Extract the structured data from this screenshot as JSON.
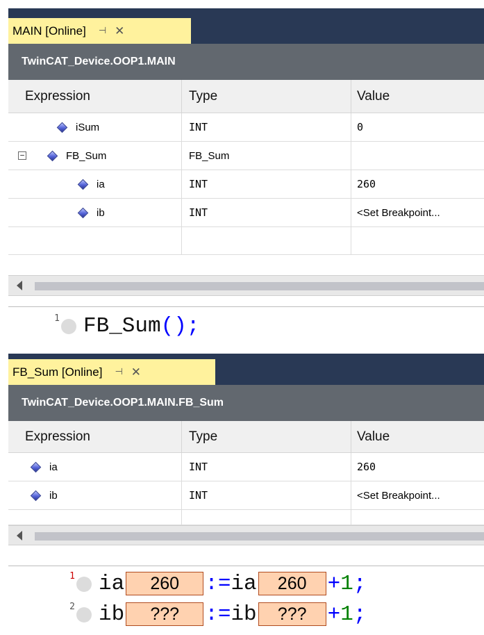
{
  "top_caption": {
    "text": ""
  },
  "panel_main": {
    "tab": {
      "title": "MAIN [Online]",
      "pin": "⊣",
      "close": "✕"
    },
    "path": "TwinCAT_Device.OOP1.MAIN",
    "columns": {
      "expression": "Expression",
      "type": "Type",
      "value": "Value"
    },
    "rows": [
      {
        "expression": "iSum",
        "type": "INT",
        "value": "0",
        "expander": ""
      },
      {
        "expression": "FB_Sum",
        "type": "FB_Sum",
        "value": "",
        "expander": "−"
      },
      {
        "expression": "ia",
        "type": "INT",
        "value": "260",
        "expander": ""
      },
      {
        "expression": "ib",
        "type": "INT",
        "value": "<Set Breakpoint...",
        "expander": ""
      }
    ],
    "code": [
      {
        "line": "1",
        "text": "FB_Sum",
        "suffix": "();"
      }
    ]
  },
  "panel_fb": {
    "tab": {
      "title": "FB_Sum [Online]",
      "pin": "⊣",
      "close": "✕"
    },
    "path": "TwinCAT_Device.OOP1.MAIN.FB_Sum",
    "columns": {
      "expression": "Expression",
      "type": "Type",
      "value": "Value"
    },
    "rows": [
      {
        "expression": "ia",
        "type": "INT",
        "value": "260"
      },
      {
        "expression": "ib",
        "type": "INT",
        "value": "<Set Breakpoint..."
      }
    ],
    "code": [
      {
        "line": "1",
        "var": "ia",
        "watch1": "260",
        "assign": ":=",
        "var2": "ia",
        "watch2": "260",
        "plus": "+",
        "one": "1",
        "semi": ";"
      },
      {
        "line": "2",
        "var": "ib",
        "watch1": "???",
        "assign": ":=",
        "var2": "ib",
        "watch2": "???",
        "plus": "+",
        "one": "1",
        "semi": ";"
      }
    ]
  }
}
